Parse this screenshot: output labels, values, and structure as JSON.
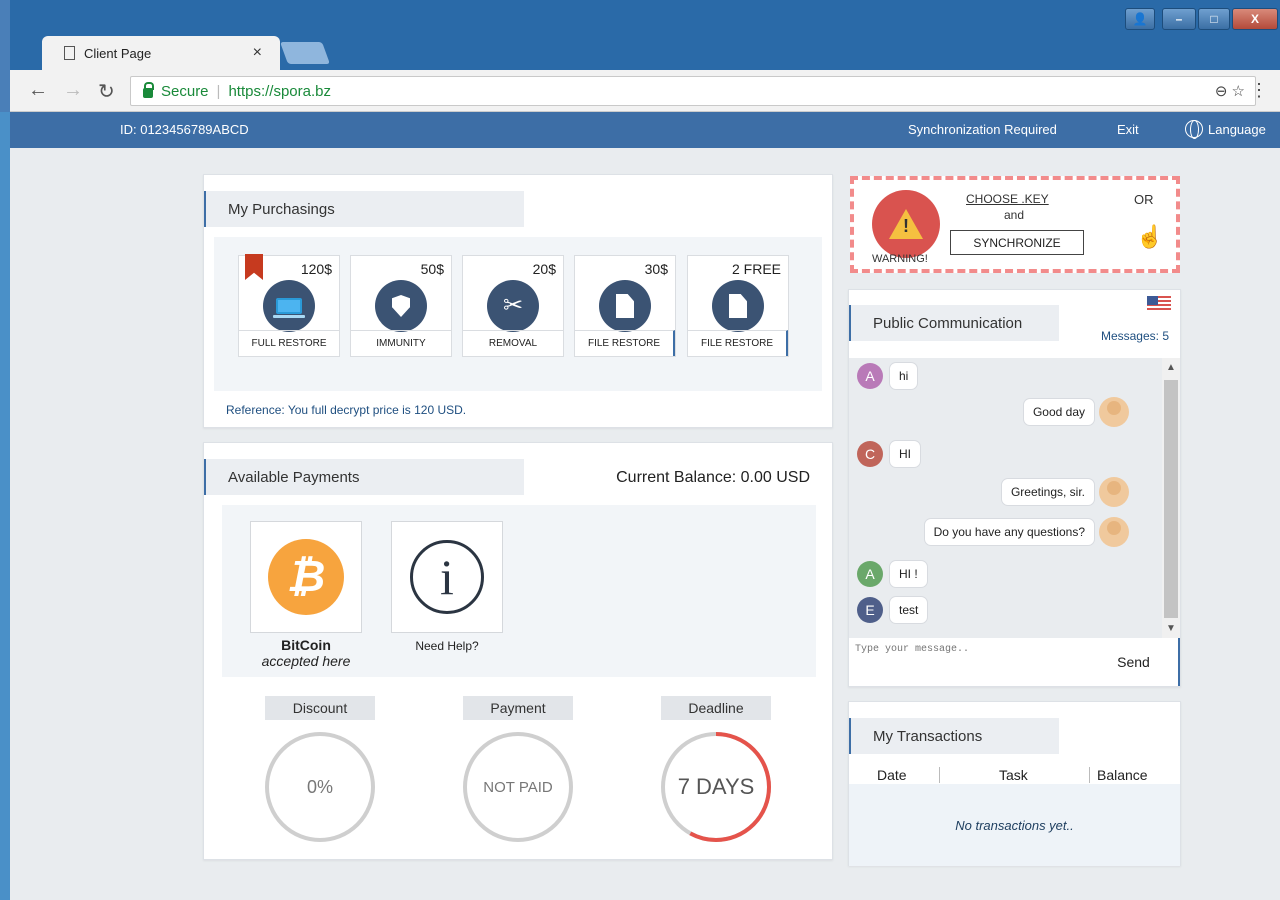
{
  "browser": {
    "tab_title": "Client Page",
    "tab_close": "×",
    "secure_label": "Secure",
    "url": "https://spora.bz",
    "window_controls": [
      "–",
      "□",
      "X"
    ]
  },
  "site_nav": {
    "id_label": "ID: 0123456789ABCD",
    "sync_label": "Synchronization Required",
    "exit_label": "Exit",
    "language_label": "Language"
  },
  "purchasings": {
    "title": "My Purchasings",
    "items": [
      {
        "price": "120$",
        "label": "FULL RESTORE",
        "icon": "laptop-icon"
      },
      {
        "price": "50$",
        "label": "IMMUNITY",
        "icon": "shield-icon"
      },
      {
        "price": "20$",
        "label": "REMOVAL",
        "icon": "tools-icon"
      },
      {
        "price": "30$",
        "label": "FILE RESTORE",
        "icon": "file-icon"
      },
      {
        "price": "2 FREE",
        "label": "FILE RESTORE",
        "icon": "file-icon"
      }
    ],
    "reference": "Reference: You full decrypt price is 120 USD."
  },
  "payments": {
    "title": "Available Payments",
    "balance": "Current Balance: 0.00 USD",
    "bitcoin_name": "BitCoin",
    "bitcoin_sub": "accepted here",
    "help_label": "Need Help?",
    "metrics": [
      {
        "title": "Discount",
        "value": "0%"
      },
      {
        "title": "Payment",
        "value": "NOT PAID"
      },
      {
        "title": "Deadline",
        "value": "7 DAYS"
      }
    ],
    "deadline_fraction": 0.58
  },
  "warning": {
    "label": "WARNING!",
    "choose_key": "CHOOSE .KEY",
    "and": "and",
    "synchronize": "SYNCHRONIZE",
    "or": "OR"
  },
  "communication": {
    "title": "Public Communication",
    "messages_count": "Messages: 5",
    "input_placeholder": "Type your message..",
    "send_label": "Send",
    "messages": [
      {
        "side": "left",
        "avatar": "A",
        "color": "#b97ab8",
        "text": "hi"
      },
      {
        "side": "right",
        "text": "Good day"
      },
      {
        "side": "left",
        "avatar": "C",
        "color": "#c0655a",
        "text": "HI"
      },
      {
        "side": "right",
        "text": "Greetings, sir."
      },
      {
        "side": "right",
        "text": "Do you have any questions?"
      },
      {
        "side": "left",
        "avatar": "A",
        "color": "#6aa86a",
        "text": "HI !"
      },
      {
        "side": "left",
        "avatar": "E",
        "color": "#4f5f8a",
        "text": "test"
      }
    ]
  },
  "transactions": {
    "title": "My Transactions",
    "columns": [
      "Date",
      "Task",
      "Balance"
    ],
    "empty": "No transactions yet.."
  }
}
